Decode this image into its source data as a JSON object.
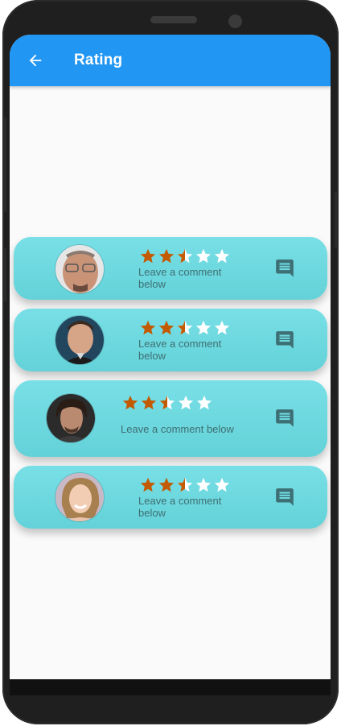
{
  "app_bar": {
    "title": "Rating"
  },
  "colors": {
    "app_bar": "#2196f3",
    "card": "#6fd9df",
    "star_filled": "#c35a00",
    "star_empty": "#ffffff",
    "comment_icon": "#3d6f74"
  },
  "icons": {
    "back": "arrow-back-icon",
    "comment": "comment-icon",
    "star": "star-icon"
  },
  "cards": [
    {
      "rating": 2.5,
      "max_rating": 5,
      "comment_prompt": "Leave a comment below"
    },
    {
      "rating": 2.5,
      "max_rating": 5,
      "comment_prompt": "Leave a comment below"
    },
    {
      "rating": 2.5,
      "max_rating": 5,
      "comment_prompt": "Leave a comment below"
    },
    {
      "rating": 2.5,
      "max_rating": 5,
      "comment_prompt": "Leave a comment below"
    }
  ]
}
